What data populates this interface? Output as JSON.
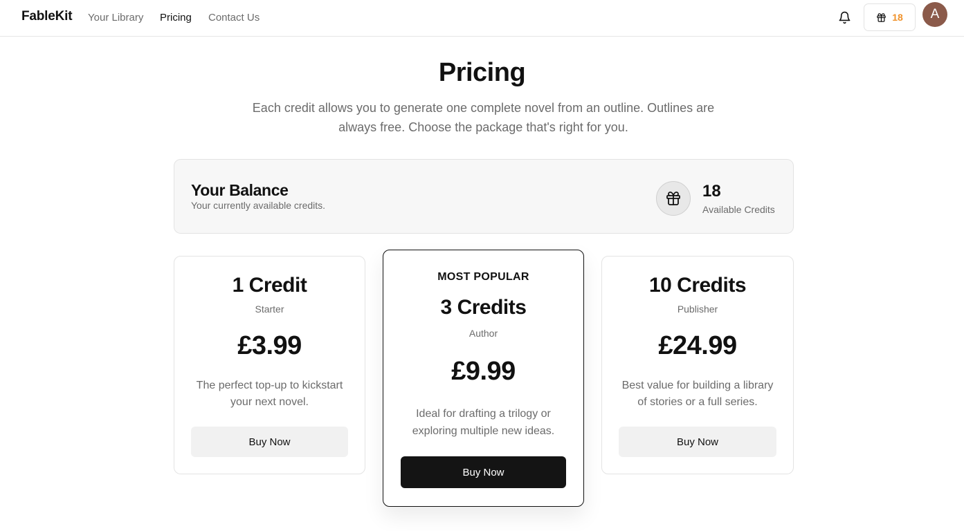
{
  "nav": {
    "brand": "FableKit",
    "links": [
      {
        "label": "Your Library",
        "active": false
      },
      {
        "label": "Pricing",
        "active": true
      },
      {
        "label": "Contact Us",
        "active": false
      }
    ],
    "credit_count": "18",
    "credit_color": "#f0922b",
    "avatar_initial": "A",
    "avatar_color": "#8b5a4a",
    "icons": {
      "notifications": "bell-icon",
      "credits": "gift-icon"
    }
  },
  "header": {
    "title": "Pricing",
    "subtitle": "Each credit allows you to generate one complete novel from an outline. Outlines are always free. Choose the package that's right for you."
  },
  "balance": {
    "title": "Your Balance",
    "description": "Your currently available credits.",
    "icon": "gift-icon",
    "amount": "18",
    "label": "Available Credits"
  },
  "plans": [
    {
      "credits": "1 Credit",
      "tier": "Starter",
      "price": "£3.99",
      "description": "The perfect top-up to kickstart your next novel.",
      "button": "Buy Now",
      "featured": false
    },
    {
      "badge": "MOST POPULAR",
      "credits": "3 Credits",
      "tier": "Author",
      "price": "£9.99",
      "description": "Ideal for drafting a trilogy or exploring multiple new ideas.",
      "button": "Buy Now",
      "featured": true
    },
    {
      "credits": "10 Credits",
      "tier": "Publisher",
      "price": "£24.99",
      "description": "Best value for building a library of stories or a full series.",
      "button": "Buy Now",
      "featured": false
    }
  ]
}
